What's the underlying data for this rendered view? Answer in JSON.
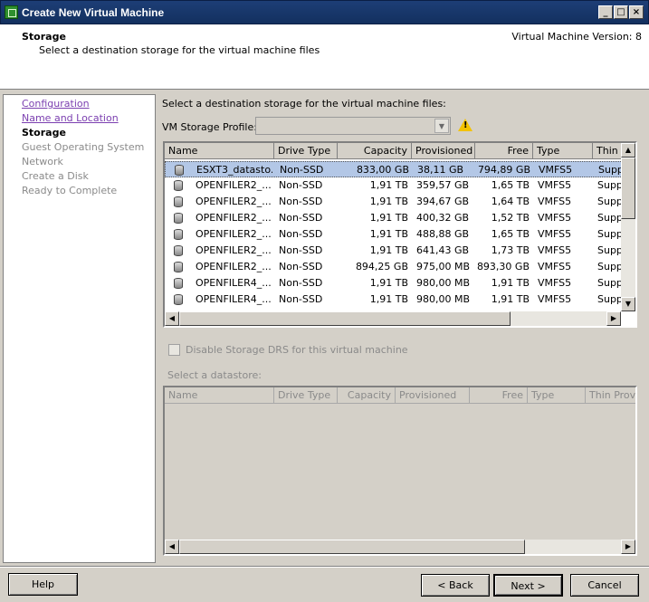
{
  "window": {
    "title": "Create New Virtual Machine",
    "min_glyph": "_",
    "max_glyph": "□",
    "close_glyph": "×"
  },
  "header": {
    "title": "Storage",
    "subtitle": "Select a destination storage for the virtual machine files",
    "version": "Virtual Machine Version: 8"
  },
  "nav": {
    "items": [
      {
        "label": "Configuration",
        "state": "link"
      },
      {
        "label": "Name and Location",
        "state": "link"
      },
      {
        "label": "Storage",
        "state": "current"
      },
      {
        "label": "Guest Operating System",
        "state": "disabled"
      },
      {
        "label": "Network",
        "state": "disabled"
      },
      {
        "label": "Create a Disk",
        "state": "disabled"
      },
      {
        "label": "Ready to Complete",
        "state": "disabled"
      }
    ]
  },
  "main": {
    "instruction": "Select a destination storage for the virtual machine files:",
    "profile_label": "VM Storage Profile:",
    "profile_value": "",
    "columns": [
      "Name",
      "Drive Type",
      "Capacity",
      "Provisioned",
      "Free",
      "Type",
      "Thin P"
    ],
    "rows": [
      {
        "name": "ESXT3_datasto...",
        "drive": "Non-SSD",
        "capacity": "833,00 GB",
        "provisioned": "38,11 GB",
        "free": "794,89 GB",
        "type": "VMFS5",
        "thin": "Supp",
        "selected": true
      },
      {
        "name": "OPENFILER2_...",
        "drive": "Non-SSD",
        "capacity": "1,91 TB",
        "provisioned": "359,57 GB",
        "free": "1,65 TB",
        "type": "VMFS5",
        "thin": "Supp"
      },
      {
        "name": "OPENFILER2_...",
        "drive": "Non-SSD",
        "capacity": "1,91 TB",
        "provisioned": "394,67 GB",
        "free": "1,64 TB",
        "type": "VMFS5",
        "thin": "Supp"
      },
      {
        "name": "OPENFILER2_...",
        "drive": "Non-SSD",
        "capacity": "1,91 TB",
        "provisioned": "400,32 GB",
        "free": "1,52 TB",
        "type": "VMFS5",
        "thin": "Supp"
      },
      {
        "name": "OPENFILER2_...",
        "drive": "Non-SSD",
        "capacity": "1,91 TB",
        "provisioned": "488,88 GB",
        "free": "1,65 TB",
        "type": "VMFS5",
        "thin": "Supp"
      },
      {
        "name": "OPENFILER2_...",
        "drive": "Non-SSD",
        "capacity": "1,91 TB",
        "provisioned": "641,43 GB",
        "free": "1,73 TB",
        "type": "VMFS5",
        "thin": "Supp"
      },
      {
        "name": "OPENFILER2_...",
        "drive": "Non-SSD",
        "capacity": "894,25 GB",
        "provisioned": "975,00 MB",
        "free": "893,30 GB",
        "type": "VMFS5",
        "thin": "Supp"
      },
      {
        "name": "OPENFILER4_...",
        "drive": "Non-SSD",
        "capacity": "1,91 TB",
        "provisioned": "980,00 MB",
        "free": "1,91 TB",
        "type": "VMFS5",
        "thin": "Supp"
      },
      {
        "name": "OPENFILER4_...",
        "drive": "Non-SSD",
        "capacity": "1,91 TB",
        "provisioned": "980,00 MB",
        "free": "1,91 TB",
        "type": "VMFS5",
        "thin": "Supp"
      }
    ],
    "checkbox_label": "Disable Storage DRS for this virtual machine",
    "select_label": "Select a datastore:",
    "columns2": [
      "Name",
      "Drive Type",
      "Capacity",
      "Provisioned",
      "Free",
      "Type",
      "Thin Provis"
    ]
  },
  "buttons": {
    "help": "Help",
    "back": "< Back",
    "next": "Next >",
    "cancel": "Cancel"
  },
  "colors": {
    "titlebar": "#13305f",
    "selection": "#b3c7e6",
    "link": "#7b3fb0"
  }
}
